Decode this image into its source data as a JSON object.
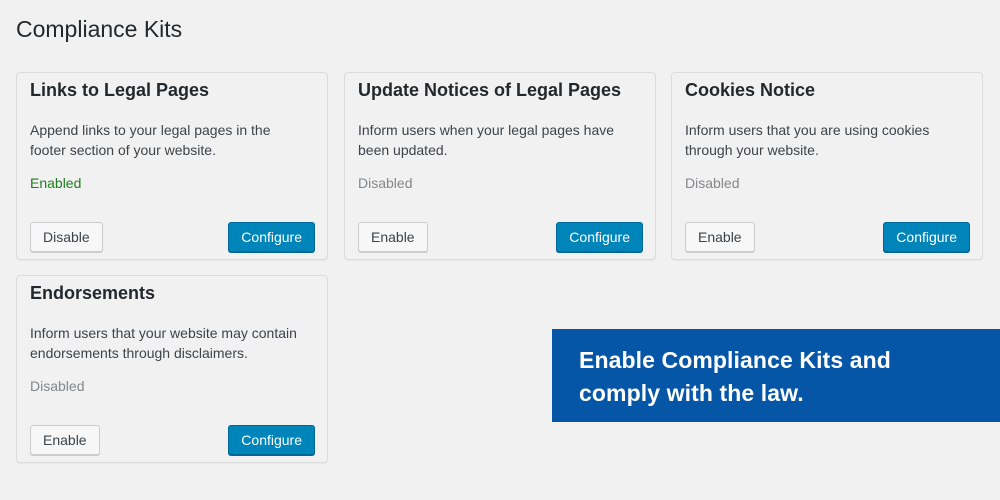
{
  "page": {
    "title": "Compliance Kits"
  },
  "cards": [
    {
      "title": "Links to Legal Pages",
      "description": "Append links to your legal pages in the footer section of your website.",
      "status": "Enabled",
      "toggle_label": "Disable",
      "configure_label": "Configure"
    },
    {
      "title": "Update Notices of Legal Pages",
      "description": "Inform users when your legal pages have been updated.",
      "status": "Disabled",
      "toggle_label": "Enable",
      "configure_label": "Configure"
    },
    {
      "title": "Cookies Notice",
      "description": "Inform users that you are using cookies through your website.",
      "status": "Disabled",
      "toggle_label": "Enable",
      "configure_label": "Configure"
    },
    {
      "title": "Endorsements",
      "description": "Inform users that your website may contain endorsements through disclaimers.",
      "status": "Disabled",
      "toggle_label": "Enable",
      "configure_label": "Configure"
    }
  ],
  "promo": {
    "line1": "Enable Compliance Kits and",
    "line2": "comply with the law."
  },
  "colors": {
    "background": "#f1f1f1",
    "primary_button": "#0085ba",
    "enabled_status": "#1e7f1e",
    "disabled_status": "#82878c",
    "promo_banner": "#0656a8"
  }
}
